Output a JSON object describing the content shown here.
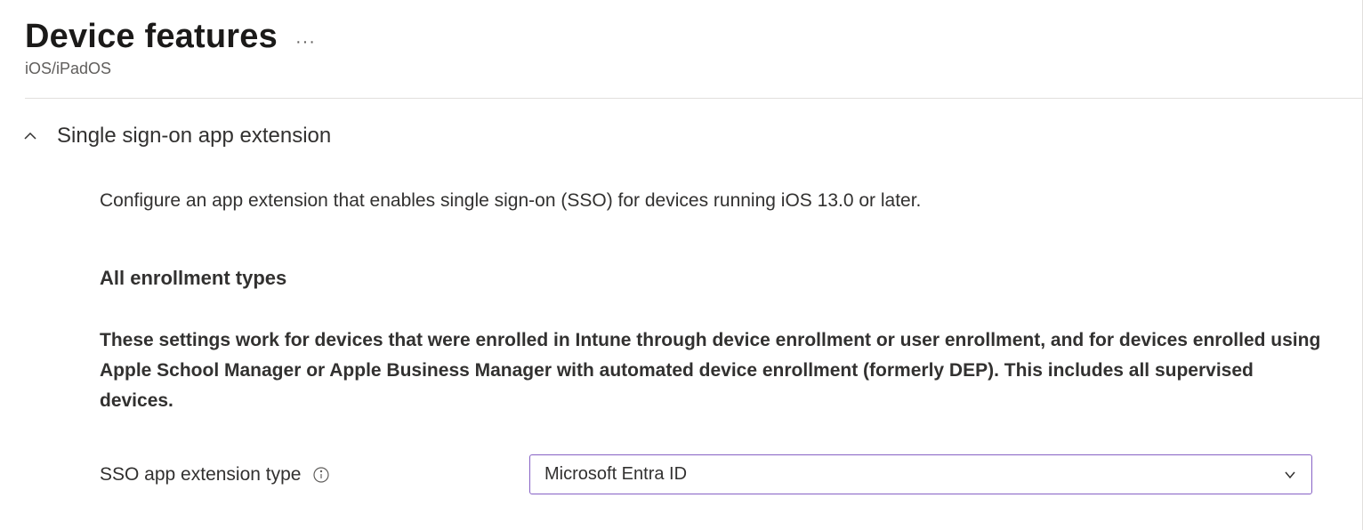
{
  "header": {
    "title": "Device features",
    "subtitle": "iOS/iPadOS"
  },
  "section": {
    "title": "Single sign-on app extension",
    "description": "Configure an app extension that enables single sign-on (SSO) for devices running iOS 13.0 or later."
  },
  "subsection": {
    "heading": "All enrollment types",
    "text": "These settings work for devices that were enrolled in Intune through device enrollment or user enrollment, and for devices enrolled using Apple School Manager or Apple Business Manager with automated device enrollment (formerly DEP). This includes all supervised devices."
  },
  "field": {
    "label": "SSO app extension type",
    "selected": "Microsoft Entra ID"
  }
}
